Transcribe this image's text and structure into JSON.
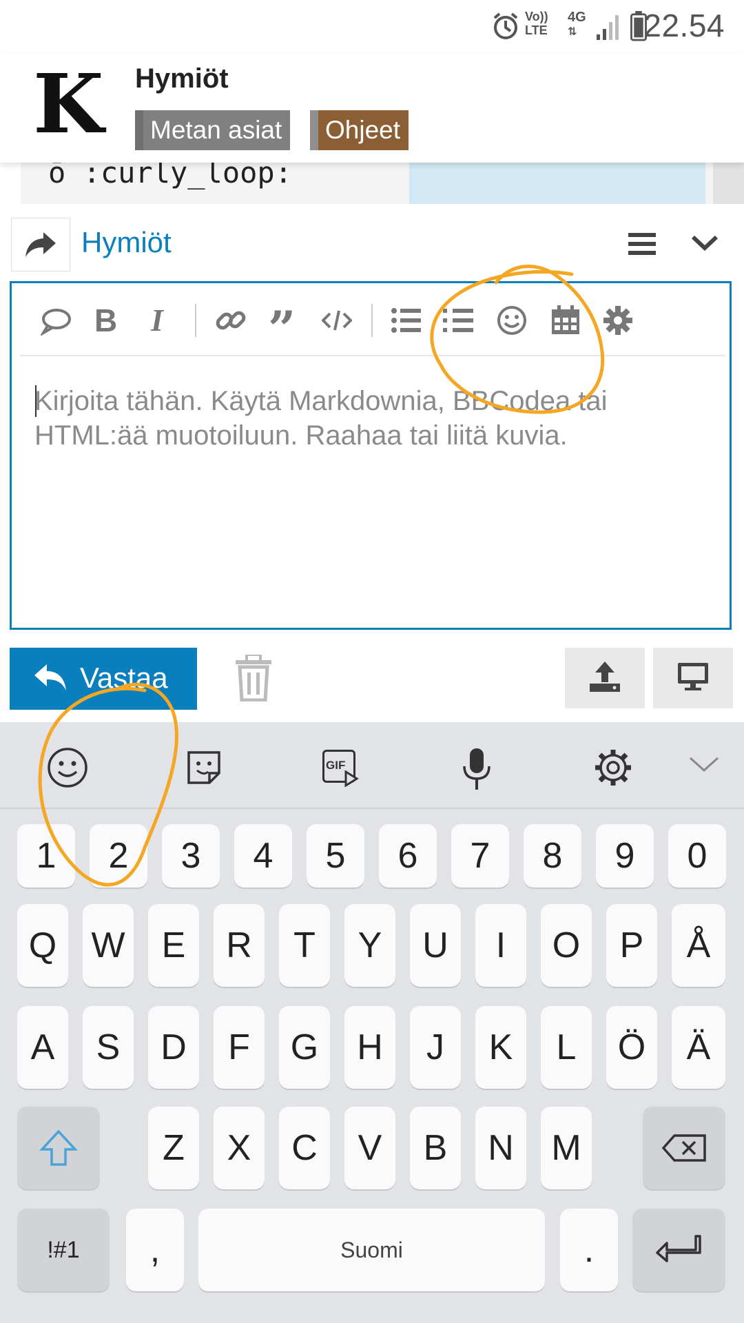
{
  "status_bar": {
    "time": "22.54",
    "network_top": "Vo))",
    "network_bottom": "LTE",
    "data_type": "4G",
    "icons": [
      "alarm-icon",
      "volte-icon",
      "data-arrows-icon",
      "signal-icon",
      "battery-icon"
    ]
  },
  "header": {
    "logo_letter": "K",
    "title": "Hymiöt",
    "tags": [
      {
        "label": "Metan asiat",
        "color": "#808080"
      },
      {
        "label": "Ohjeet",
        "color": "#8b5e34"
      }
    ]
  },
  "peek_row": {
    "emoji_code": "ō :curly_loop:"
  },
  "composer": {
    "title": "Hymiöt",
    "toolbar": [
      "quote-bubble-icon",
      "bold-icon",
      "italic-icon",
      "link-icon",
      "blockquote-icon",
      "code-icon",
      "bullet-list-icon",
      "numbered-list-icon",
      "emoji-icon",
      "calendar-icon",
      "gear-icon"
    ],
    "placeholder": "Kirjoita tähän. Käytä Markdownia, BBCodea tai HTML:ää muotoiluun. Raahaa tai liitä kuvia.",
    "reply_button": "Vastaa"
  },
  "keyboard": {
    "tools": [
      "emoji-icon",
      "sticker-icon",
      "gif-icon",
      "microphone-icon",
      "settings-icon",
      "chevron-down-icon"
    ],
    "gif_label": "GIF",
    "row_numbers": [
      "1",
      "2",
      "3",
      "4",
      "5",
      "6",
      "7",
      "8",
      "9",
      "0"
    ],
    "row1": [
      "Q",
      "W",
      "E",
      "R",
      "T",
      "Y",
      "U",
      "I",
      "O",
      "P",
      "Å"
    ],
    "row2": [
      "A",
      "S",
      "D",
      "F",
      "G",
      "H",
      "J",
      "K",
      "L",
      "Ö",
      "Ä"
    ],
    "row3": [
      "Z",
      "X",
      "C",
      "V",
      "B",
      "N",
      "M"
    ],
    "symbols_key": "!#1",
    "comma_key": ",",
    "space_label": "Suomi",
    "period_key": "."
  },
  "colors": {
    "accent": "#0a7fbd",
    "annotation": "#f5a623"
  }
}
